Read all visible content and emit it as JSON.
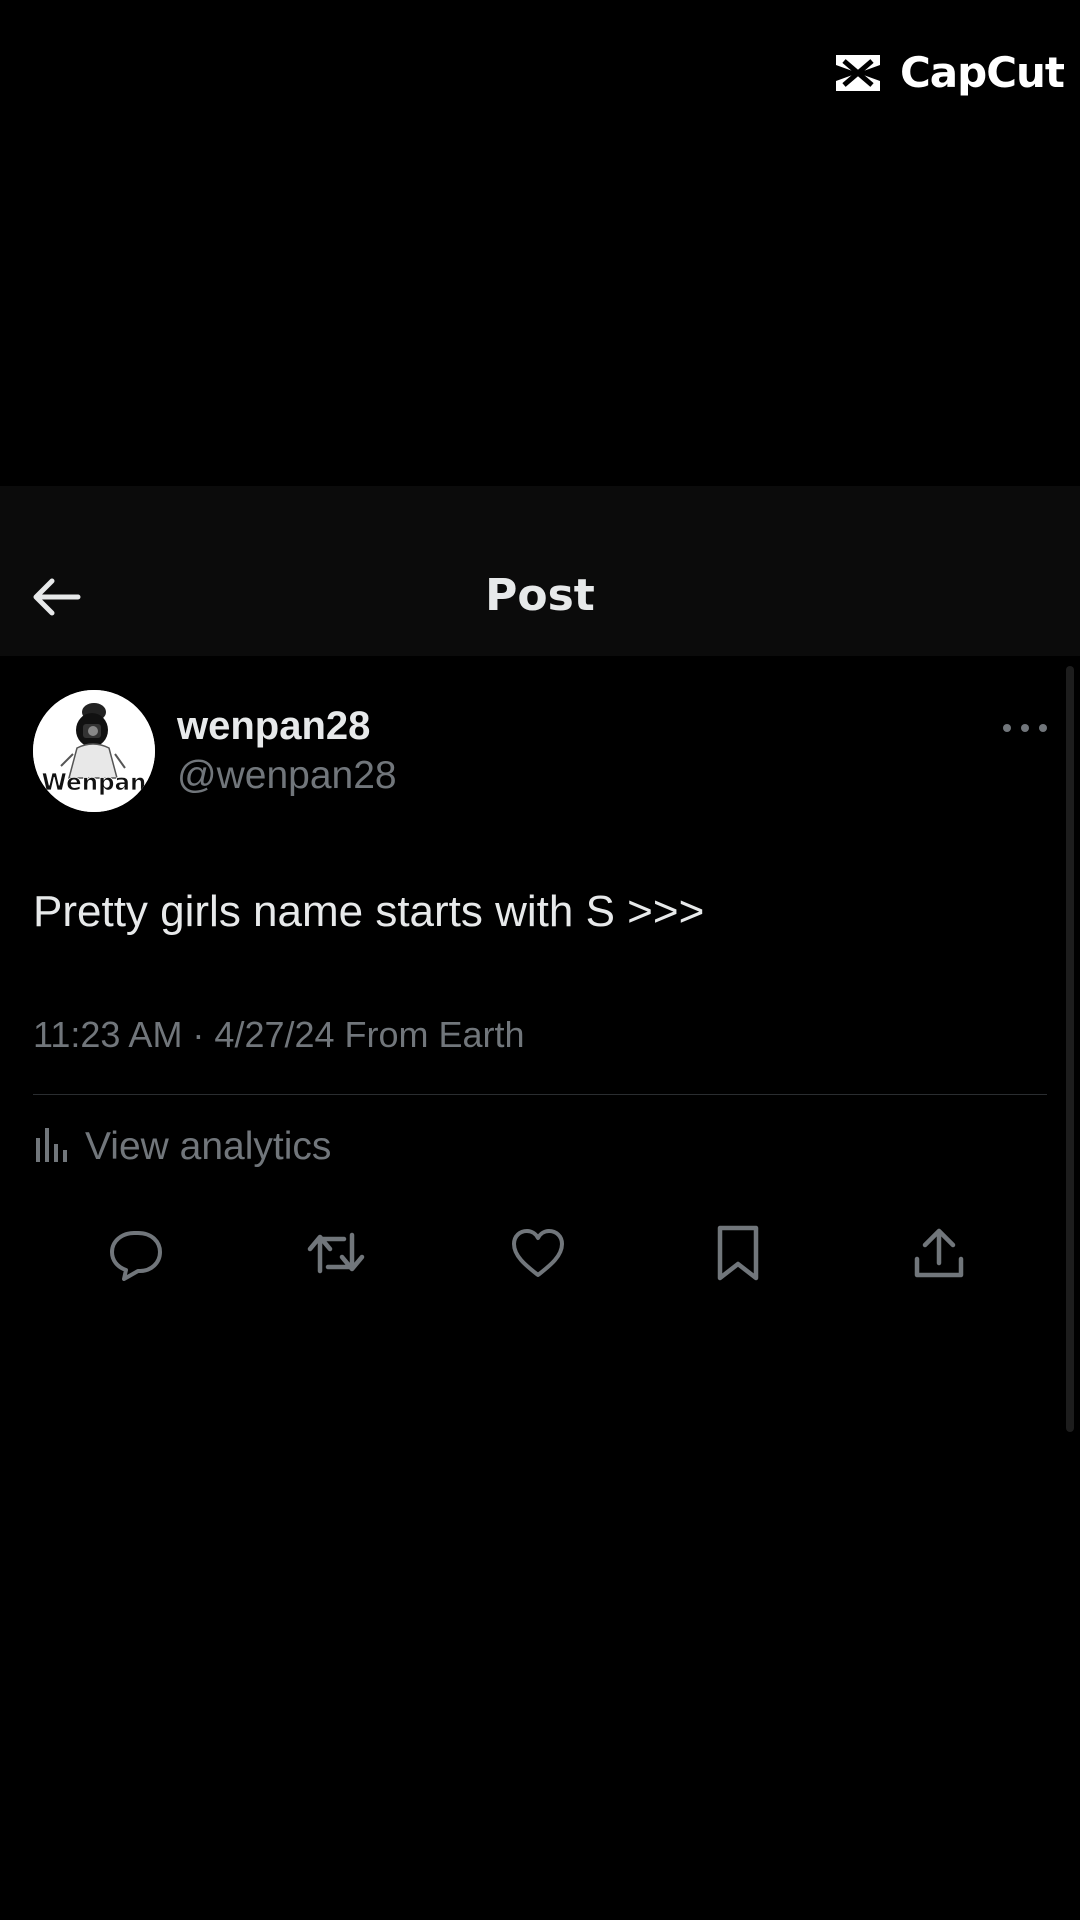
{
  "watermark": {
    "text": "CapCut",
    "icon": "capcut-logo-icon"
  },
  "header": {
    "title": "Post",
    "back_icon": "arrow-left-icon"
  },
  "post": {
    "avatar_text": "Wenpan",
    "display_name": "wenpan28",
    "handle": "@wenpan28",
    "more_icon": "more-horizontal-icon",
    "text": "Pretty girls name starts with S >>>",
    "meta": "11:23 AM · 4/27/24 From Earth",
    "analytics_label": "View analytics",
    "analytics_icon": "bar-chart-icon"
  },
  "actions": [
    {
      "name": "reply",
      "icon": "reply-icon"
    },
    {
      "name": "repost",
      "icon": "repost-icon"
    },
    {
      "name": "like",
      "icon": "heart-icon"
    },
    {
      "name": "bookmark",
      "icon": "bookmark-icon"
    },
    {
      "name": "share",
      "icon": "share-icon"
    }
  ],
  "colors": {
    "background": "#000000",
    "header_background": "#0b0b0b",
    "primary_text": "#e7e9ea",
    "secondary_text": "#71767b",
    "divider": "#2a2d30"
  }
}
